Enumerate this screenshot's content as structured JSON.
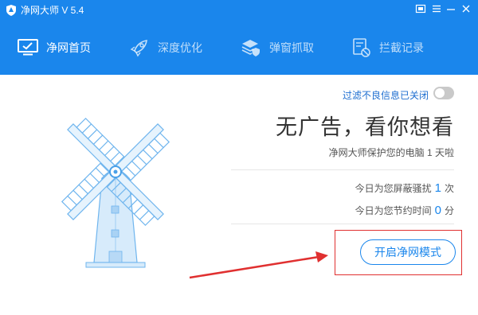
{
  "app": {
    "title": "净网大师 V 5.4",
    "colors": {
      "header": "#1a86ec",
      "accent": "#1a86ec",
      "annotation": "#e03030"
    }
  },
  "titlebar": {
    "window_buttons": [
      {
        "icon": "skin-icon"
      },
      {
        "icon": "menu-icon"
      },
      {
        "icon": "minimize-icon"
      },
      {
        "icon": "close-icon"
      }
    ]
  },
  "nav": {
    "items": [
      {
        "label": "净网首页",
        "icon": "monitor-icon",
        "active": true
      },
      {
        "label": "深度优化",
        "icon": "rocket-icon",
        "active": false
      },
      {
        "label": "弹窗抓取",
        "icon": "layers-shield-icon",
        "active": false
      },
      {
        "label": "拦截记录",
        "icon": "blocked-log-icon",
        "active": false
      }
    ]
  },
  "main": {
    "filter_toggle": {
      "label": "过滤不良信息已关闭",
      "on": false
    },
    "slogan": "无广告，看你想看",
    "protection": "净网大师保护您的电脑 1 天啦",
    "stats": [
      {
        "prefix": "今日为您屏蔽骚扰",
        "value": "1",
        "unit": "次"
      },
      {
        "prefix": "今日为您节约时间",
        "value": "0",
        "unit": "分"
      }
    ],
    "open_button": "开启净网模式"
  }
}
